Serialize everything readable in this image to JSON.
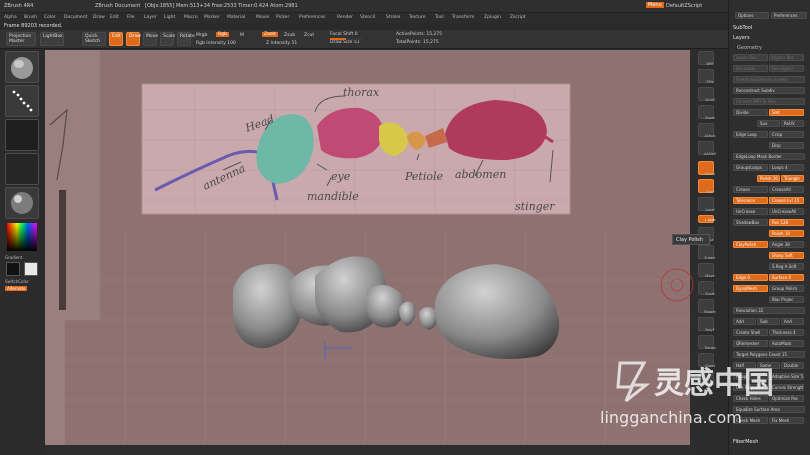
{
  "window": {
    "app": "ZBrush 4R4",
    "document": "ZBrush Document",
    "stats": "[Objs:1855] Mem:513+34 Free:2533 Timer:0.424 Atom:2981",
    "menu_label": "Menu",
    "script_label": "DefaultZScript"
  },
  "menus": [
    "Alpha",
    "Brush",
    "Color",
    "Document",
    "Draw",
    "Edit",
    "File",
    "Layer",
    "Light",
    "Macro",
    "Marker",
    "Material",
    "Movie",
    "Picker",
    "Preferences",
    "Render",
    "Stencil",
    "Stroke",
    "Texture",
    "Tool",
    "Transform",
    "Zplugin",
    "Zscript"
  ],
  "status": "Frame 89203 recorded.",
  "shelf": {
    "projection_master": "Projection Master",
    "lightbox": "LightBox",
    "quick_sketch": "Quick Sketch",
    "edit": "Edit",
    "draw": "Draw",
    "move": "Move",
    "scale": "Scale",
    "rotate": "Rotate",
    "mrgb": "Mrgb",
    "rgb": "Rgb",
    "m": "M",
    "zadd": "Zadd",
    "zsub": "Zsub",
    "zcut": "Zcut",
    "rgb_intensity": "Rgb Intensity 100",
    "z_intensity": "Z Intensity 51",
    "focal_shift": "Focal Shift 0",
    "draw_size": "Draw Size 51",
    "active_points": "ActivePoints: 15,275",
    "total_points": "TotalPoints: 15,275"
  },
  "left_tray": {
    "tile_labels": [
      "",
      "",
      "",
      "",
      ""
    ],
    "gradient": "Gradient",
    "switch_color": "SwitchColor",
    "alternate": "Alternate"
  },
  "right_dock": {
    "labels": [
      "BPR",
      "SPix",
      "Scroll",
      "Zoom",
      "Actual",
      "AAHalf",
      "Persp",
      "Floor",
      "Local",
      "L.Sym",
      "Xyz",
      "Frame",
      "Move",
      "Scale",
      "Rotate",
      "PolyF",
      "Transp",
      "Ghost",
      "Solo"
    ]
  },
  "tooltip": "Clay Polish",
  "subpalette": {
    "tabs": [
      "Options",
      "Preferences"
    ],
    "subtool": "SubTool",
    "layers": "Layers",
    "geometry": "Geometry",
    "rows": [
      [
        "Lower Res",
        "Higher Res"
      ],
      [
        "Del Lower",
        "Del Higher"
      ],
      [
        "Freeze SubDivision Levels",
        ""
      ],
      [
        "Reconstruct Subdiv",
        ""
      ],
      [
        "Convert BPR To Geo",
        ""
      ],
      [
        "Divide",
        "Smt"
      ],
      [
        "",
        "Suv",
        "ReUV"
      ],
      [
        "Edge Loop",
        "Crisp"
      ],
      [
        "",
        "Disp"
      ],
      [
        "EdgeLoop Mask Border",
        ""
      ],
      [
        "GroupsLoops",
        "Loops 4"
      ],
      [
        "",
        "Polish 10",
        "Triangle"
      ],
      [
        "Crease",
        "CreaseAll"
      ],
      [
        "Tolerance",
        "Crease Lvl 15"
      ],
      [
        "UnCrease",
        "UnCreaseAll"
      ],
      [
        "ShadowBox",
        "Res 128"
      ],
      [
        "",
        "Polish 10"
      ],
      [
        "ClayPolish",
        "Angle 38"
      ],
      [
        "",
        "Sharp Soft"
      ],
      [
        "",
        "S.Reg A.Soft"
      ],
      [
        "Edge 0",
        "Surface 0"
      ],
      [
        "DynaMesh",
        "Group Polish"
      ],
      [
        "",
        "Blur Projec"
      ],
      [
        "Resolution 32",
        ""
      ],
      [
        "Add",
        "Sub",
        "And"
      ],
      [
        "Create Shell",
        "Thickness 4"
      ],
      [
        "QRemesher",
        "AutoMask"
      ],
      [
        "Target Polygons Count 15",
        ""
      ],
      [
        "Half",
        "Same",
        "Double"
      ],
      [
        "Adapt",
        "Adaptive Size 50"
      ],
      [
        "Use Polypaint",
        "Curves Strength 50"
      ],
      [
        "Check Holes",
        "Optimize Pos"
      ],
      [
        "Equalize Surface Area",
        ""
      ],
      [
        "Check Mesh",
        "Fix Mesh"
      ]
    ],
    "fibermesh": "FiberMesh"
  },
  "sketch": {
    "labels": {
      "head": "Head",
      "thorax": "thorax",
      "antenna": "antenna",
      "eye": "eye",
      "mandible": "mandible",
      "petiole": "Petiole",
      "abdomen": "abdomen",
      "stinger": "stinger"
    }
  },
  "watermark": {
    "chinese": "灵感中国",
    "url": "lingganchina.com"
  },
  "colors": {
    "accent": "#e06a1b",
    "canvas": "#8e7272",
    "head": "#6fb8a6",
    "thorax": "#c04a74",
    "thorax_yellow": "#d8c84a",
    "petiole": "#d8964a",
    "abdomen": "#b03a5a",
    "antenna": "#6a5ab0",
    "sketch_line": "#555555"
  }
}
